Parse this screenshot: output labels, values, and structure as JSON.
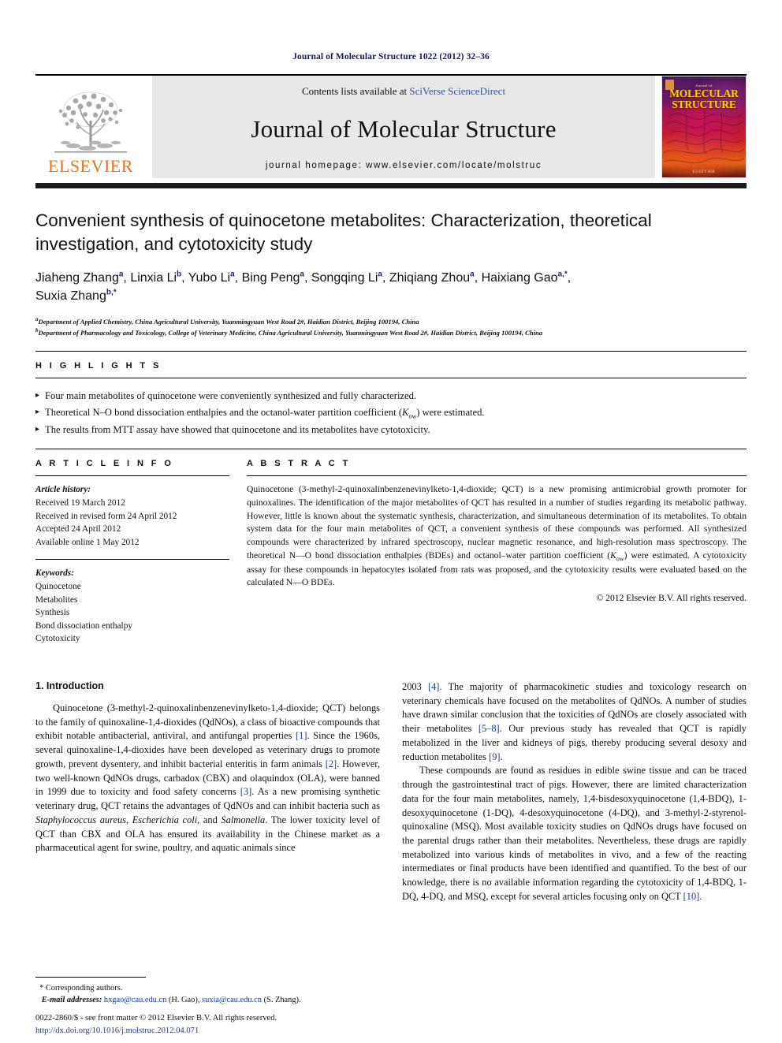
{
  "running_head": "Journal of Molecular Structure 1022 (2012) 32–36",
  "masthead": {
    "elsevier_wordmark": "ELSEVIER",
    "contents_prefix": "Contents lists available at ",
    "contents_link": "SciVerse ScienceDirect",
    "journal_name": "Journal of Molecular Structure",
    "homepage": "journal homepage: www.elsevier.com/locate/molstruc",
    "cover": {
      "top_label": "Journal of",
      "title_line1": "MOLECULAR",
      "title_line2": "STRUCTURE",
      "publisher": "ELSEVIER"
    }
  },
  "article": {
    "title": "Convenient synthesis of quinocetone metabolites: Characterization, theoretical investigation, and cytotoxicity study",
    "authors_line1_html": "Jiaheng Zhang<sup>a</sup>, Linxia Li<sup>b</sup>, Yubo Li<sup>a</sup>, Bing Peng<sup>a</sup>, Songqing Li<sup>a</sup>, Zhiqiang Zhou<sup>a</sup>, Haixiang Gao<sup>a,*</sup>,",
    "authors_line2_html": "Suxia Zhang<sup>b,*</sup>",
    "affiliation_a_html": "<sup>a</sup>Department of Applied Chemistry, China Agricultural University, Yuanmingyuan West Road 2#, Haidian District, Beijing 100194, China",
    "affiliation_b_html": "<sup>b</sup>Department of Pharmacology and Toxicology, College of Veterinary Medicine, China Agricultural University, Yuanmingyuan West Road 2#, Haidian District, Beijing 100194, China"
  },
  "highlights": {
    "heading": "H I G H L I G H T S",
    "items_html": [
      "Four main metabolites of quinocetone were conveniently synthesized and fully characterized.",
      "Theoretical N–O bond dissociation enthalpies and the octanol-water partition coefficient (<i>K</i><sub>ow</sub>) were estimated.",
      "The results from MTT assay have showed that quinocetone and its metabolites have cytotoxicity."
    ]
  },
  "article_info": {
    "heading": "A R T I C L E   I N F O",
    "history_label": "Article history:",
    "history": [
      "Received 19 March 2012",
      "Received in revised form 24 April 2012",
      "Accepted 24 April 2012",
      "Available online 1 May 2012"
    ],
    "keywords_label": "Keywords:",
    "keywords": [
      "Quinocetone",
      "Metabolites",
      "Synthesis",
      "Bond dissociation enthalpy",
      "Cytotoxicity"
    ]
  },
  "abstract": {
    "heading": "A B S T R A C T",
    "text_html": "Quinocetone (3-methyl-2-quinoxalinbenzenevinylketo-1,4-dioxide; QCT) is a new promising antimicrobial growth promoter for quinoxalines. The identification of the major metabolites of QCT has resulted in a number of studies regarding its metabolic pathway. However, little is known about the systematic synthesis, characterization, and simultaneous determination of its metabolites. To obtain system data for the four main metabolites of QCT, a convenient synthesis of these compounds was performed. All synthesized compounds were characterized by infrared spectroscopy, nuclear magnetic resonance, and high-resolution mass spectroscopy. The theoretical N—O bond dissociation enthalpies (BDEs) and octanol–water partition coefficient (<i>K</i><sub>ow</sub>) were estimated. A cytotoxicity assay for these compounds in hepatocytes isolated from rats was proposed, and the cytotoxicity results were evaluated based on the calculated N—O BDEs.",
    "copyright": "© 2012 Elsevier B.V. All rights reserved."
  },
  "body": {
    "section_heading": "1. Introduction",
    "left_paragraphs_html": [
      "Quinocetone (3-methyl-2-quinoxalinbenzenevinylketo-1,4-dioxide; QCT) belongs to the family of quinoxaline-1,4-dioxides (QdNOs), a class of bioactive compounds that exhibit notable antibacterial, antiviral, and antifungal properties <span class=\"ref\">[1]</span>. Since the 1960s, several quinoxaline-1,4-dioxides have been developed as veterinary drugs to promote growth, prevent dysentery, and inhibit bacterial enteritis in farm animals <span class=\"ref\">[2]</span>. However, two well-known QdNOs drugs, carbadox (CBX) and olaquindox (OLA), were banned in 1999 due to toxicity and food safety concerns <span class=\"ref\">[3]</span>. As a new promising synthetic veterinary drug, QCT retains the advantages of QdNOs and can inhibit bacteria such as <i>Staphylococcus aureus</i>, <i>Escherichia coli</i>, and <i>Salmonella</i>. The lower toxicity level of QCT than CBX and OLA has ensured its availability in the Chinese market as a pharmaceutical agent for swine, poultry, and aquatic animals since"
    ],
    "right_paragraphs_html": [
      "2003 <span class=\"ref\">[4]</span>. The majority of pharmacokinetic studies and toxicology research on veterinary chemicals have focused on the metabolites of QdNOs. A number of studies have drawn similar conclusion that the toxicities of QdNOs are closely associated with their metabolites <span class=\"ref\">[5–8]</span>. Our previous study has revealed that QCT is rapidly metabolized in the liver and kidneys of pigs, thereby producing several desoxy and reduction metabolites <span class=\"ref\">[9]</span>.",
      "These compounds are found as residues in edible swine tissue and can be traced through the gastrointestinal tract of pigs. However, there are limited characterization data for the four main metabolites, namely, 1,4-bisdesoxyquinocetone (1,4-BDQ), 1-desoxyquinocetone (1-DQ), 4-desoxyquinocetone (4-DQ), and 3-methyl-2-styrenol-quinoxaline (MSQ). Most available toxicity studies on QdNOs drugs have focused on the parental drugs rather than their metabolites. Nevertheless, these drugs are rapidly metabolized into various kinds of metabolites in vivo, and a few of the reacting intermediates or final products have been identified and quantified. To the best of our knowledge, there is no available information regarding the cytotoxicity of 1,4-BDQ, 1-DQ, 4-DQ, and MSQ, except for several articles focusing only on QCT <span class=\"ref\">[10]</span>."
    ]
  },
  "footer": {
    "corresponding_star": "*",
    "corresponding_label": "Corresponding authors.",
    "email_label": "E-mail addresses:",
    "email_1": "hxgao@cau.edu.cn",
    "email_1_owner": "(H. Gao),",
    "email_2": "suxia@cau.edu.cn",
    "email_2_owner": "(S. Zhang).",
    "issn_line": "0022-2860/$ - see front matter © 2012 Elsevier B.V. All rights reserved.",
    "doi_line": "http://dx.doi.org/10.1016/j.molstruc.2012.04.071"
  },
  "colors": {
    "elsevier_orange": "#e8731f",
    "link_blue": "#1b3b8f",
    "running_head_navy": "#131c4e",
    "masthead_grey": "#e8e8e8"
  }
}
